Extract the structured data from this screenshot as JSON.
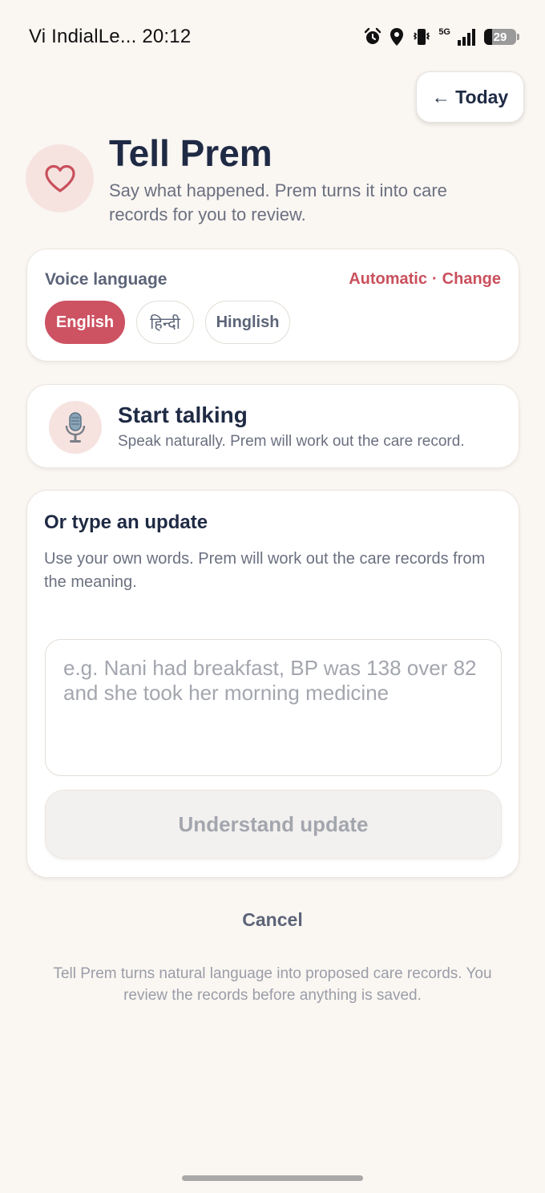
{
  "status_bar": {
    "carrier_time": "Vi IndialLe... 20:12",
    "network": "5G",
    "battery": "29"
  },
  "header": {
    "today_button": "← Today",
    "title": "Tell Prem",
    "subtitle": "Say what happened. Prem turns it into care records for you to review."
  },
  "voice_language": {
    "label": "Voice language",
    "mode": "Automatic",
    "separator": "·",
    "change_link": "Change",
    "options": [
      "English",
      "हिन्दी",
      "Hinglish"
    ],
    "selected": "English"
  },
  "start_talking": {
    "title": "Start talking",
    "subtitle": "Speak naturally. Prem will work out the care record."
  },
  "type_update": {
    "title": "Or type an update",
    "description": "Use your own words. Prem will work out the care records from the meaning.",
    "input_value": "",
    "placeholder": "e.g. Nani had breakfast, BP was 138 over 82 and she took her morning medicine",
    "submit_label": "Understand update"
  },
  "cancel_label": "Cancel",
  "footnote": "Tell Prem turns natural language into proposed care records. You review the records before anything is saved.",
  "colors": {
    "background": "#faf6f2",
    "accent": "#cd5262",
    "navy": "#1f2a44",
    "muted": "#6b7080",
    "icon_bg": "#f6e3e0"
  },
  "icons": {
    "heart": "heart-icon",
    "mic": "microphone-icon",
    "alarm": "alarm-icon",
    "location": "location-icon",
    "vibrate": "vibrate-icon",
    "signal": "signal-icon",
    "battery": "battery-icon"
  }
}
